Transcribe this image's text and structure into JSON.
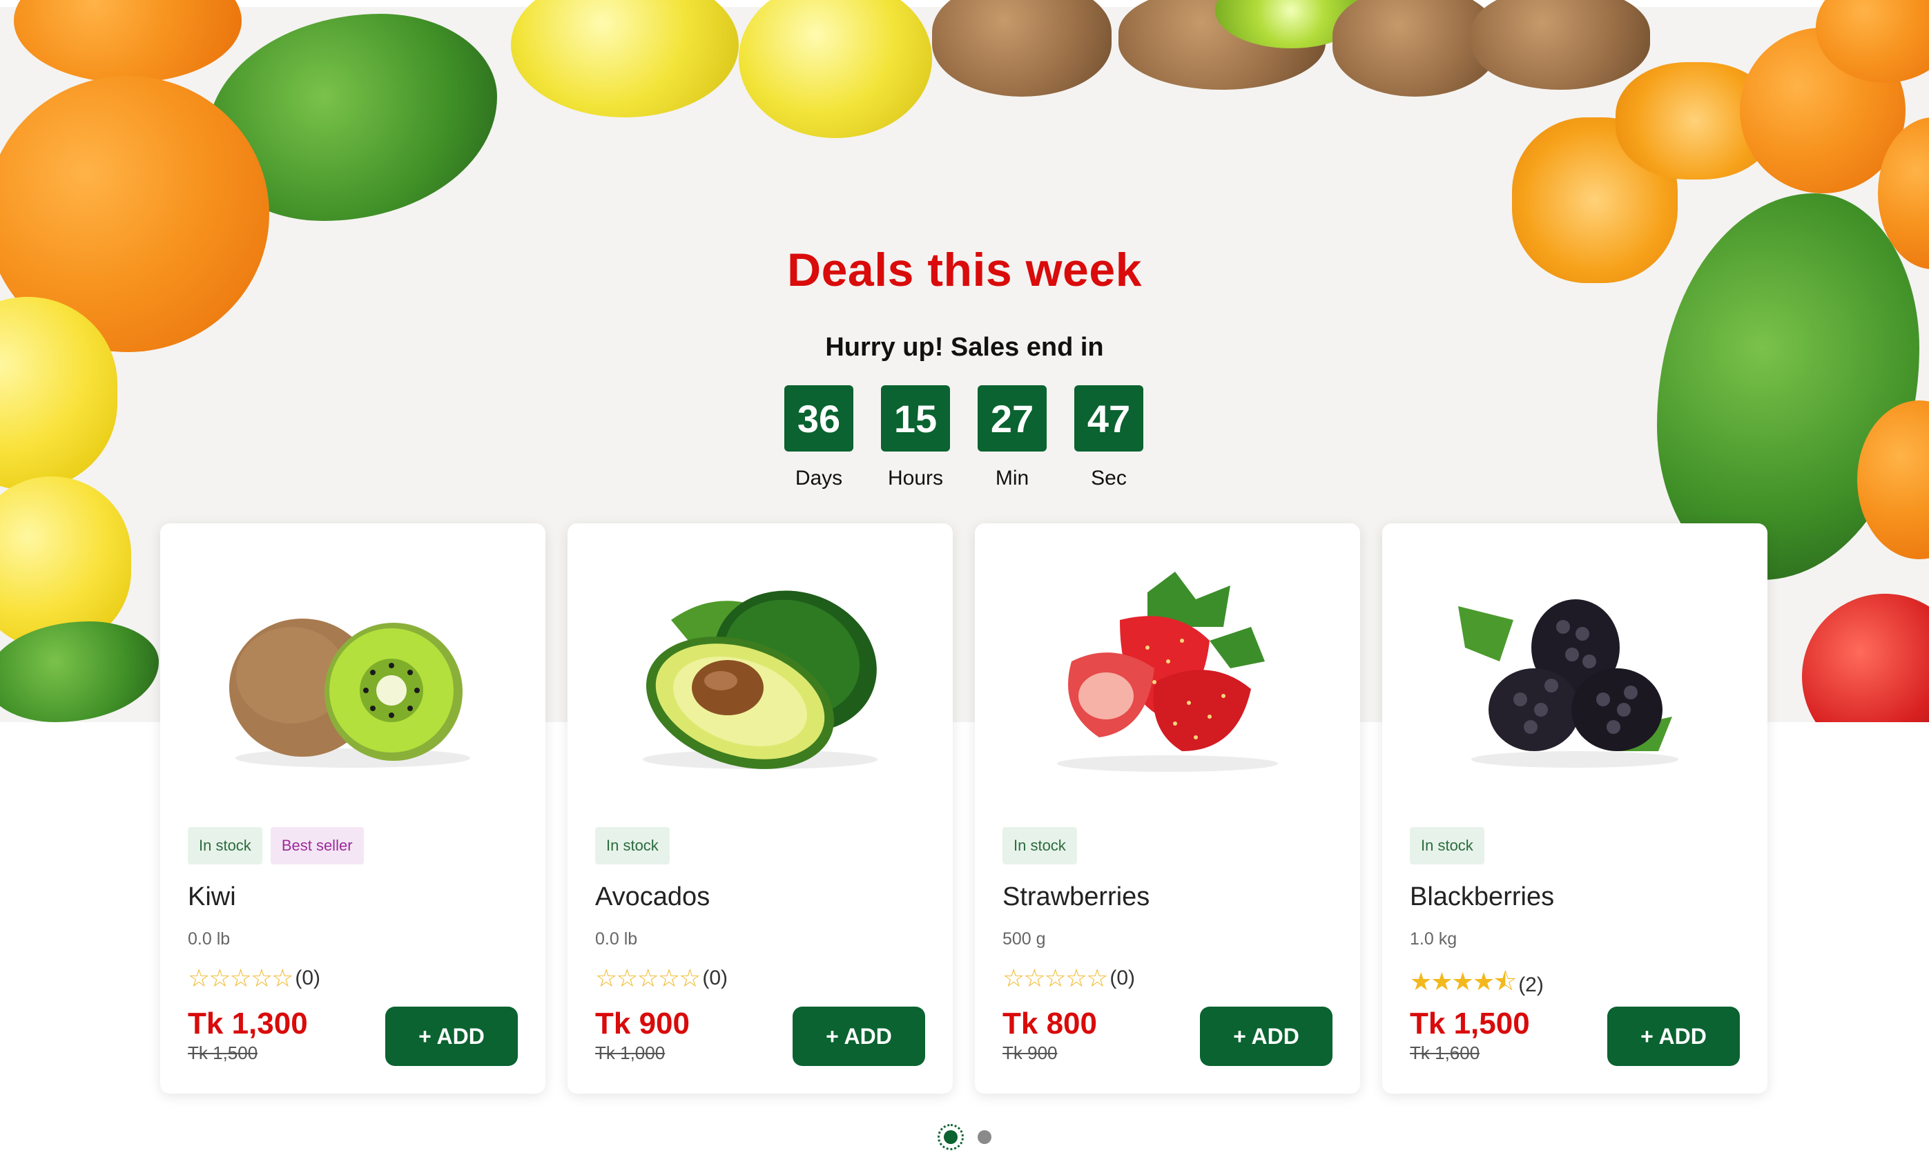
{
  "section": {
    "title": "Deals this week",
    "subtitle": "Hurry up! Sales end in"
  },
  "countdown": [
    {
      "value": "36",
      "label": "Days"
    },
    {
      "value": "15",
      "label": "Hours"
    },
    {
      "value": "27",
      "label": "Min"
    },
    {
      "value": "47",
      "label": "Sec"
    }
  ],
  "products": [
    {
      "name": "Kiwi",
      "weight": "0.0 lb",
      "badges": [
        "In stock",
        "Best seller"
      ],
      "rating_count": "(0)",
      "rating_stars": 0,
      "price": "Tk 1,300",
      "old_price": "Tk 1,500",
      "add_label": "+ ADD",
      "image_icon": "kiwi-icon"
    },
    {
      "name": "Avocados",
      "weight": "0.0 lb",
      "badges": [
        "In stock"
      ],
      "rating_count": "(0)",
      "rating_stars": 0,
      "price": "Tk 900",
      "old_price": "Tk 1,000",
      "add_label": "+ ADD",
      "image_icon": "avocado-icon"
    },
    {
      "name": "Strawberries",
      "weight": "500 g",
      "badges": [
        "In stock"
      ],
      "rating_count": "(0)",
      "rating_stars": 0,
      "price": "Tk 800",
      "old_price": "Tk 900",
      "add_label": "+ ADD",
      "image_icon": "strawberry-icon"
    },
    {
      "name": "Blackberries",
      "weight": "1.0 kg",
      "badges": [
        "In stock"
      ],
      "rating_count": "(2)",
      "rating_stars": 4.5,
      "price": "Tk 1,500",
      "old_price": "Tk 1,600",
      "add_label": "+ ADD",
      "image_icon": "blackberry-icon"
    }
  ],
  "pagination": {
    "pages": 2,
    "active": 1
  },
  "colors": {
    "brand_green": "#0a6330",
    "deal_red": "#d90b0b",
    "star_gold": "#f2b81e",
    "hero_bg": "#f4f3f1"
  }
}
